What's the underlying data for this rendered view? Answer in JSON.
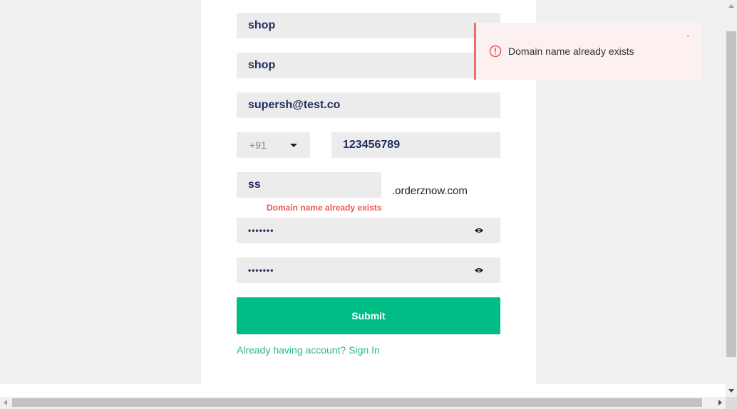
{
  "form": {
    "first_name_value": "shop",
    "last_name_value": "shop",
    "email_value": "supersh@test.co",
    "country_code_value": "+91",
    "phone_value": "123456789",
    "domain_value": "ss",
    "domain_suffix": ".orderznow.com",
    "domain_error": "Domain name already exists",
    "password_value": "•••••••",
    "confirm_password_value": "•••••••",
    "submit_label": "Submit",
    "signin_link": "Already having account? Sign In"
  },
  "toast": {
    "message": "Domain name already exists",
    "accent_color": "#ea6b6b",
    "icon": "info-circle-icon"
  },
  "colors": {
    "primary": "#00bd86",
    "error": "#e65a5a",
    "field_text": "#1f2a5c"
  }
}
